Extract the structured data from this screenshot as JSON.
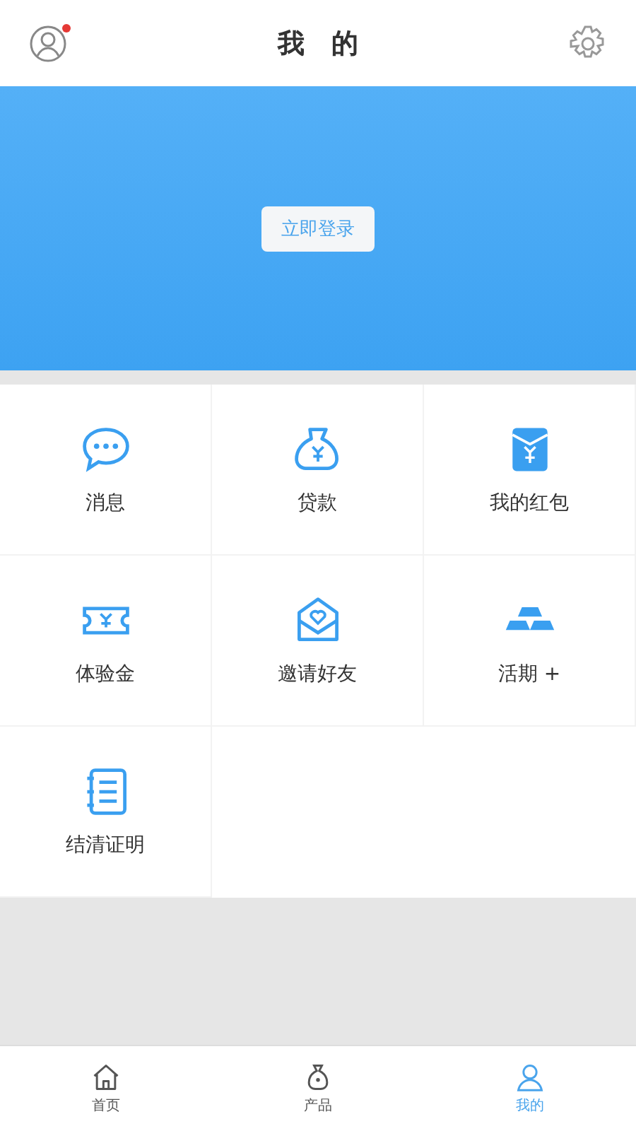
{
  "header": {
    "title": "我　的",
    "has_notification": true
  },
  "banner": {
    "login_button": "立即登录"
  },
  "menu": [
    {
      "label": "消息",
      "kind": "message"
    },
    {
      "label": "贷款",
      "kind": "moneybag"
    },
    {
      "label": "我的红包",
      "kind": "redpacket"
    },
    {
      "label": "体验金",
      "kind": "ticket"
    },
    {
      "label": "邀请好友",
      "kind": "invite"
    },
    {
      "label": "活期 +",
      "kind": "gold"
    },
    {
      "label": "结清证明",
      "kind": "document"
    }
  ],
  "tabs": [
    {
      "label": "首页",
      "kind": "home",
      "selected": false
    },
    {
      "label": "产品",
      "kind": "product",
      "selected": false
    },
    {
      "label": "我的",
      "kind": "me",
      "selected": true
    }
  ]
}
